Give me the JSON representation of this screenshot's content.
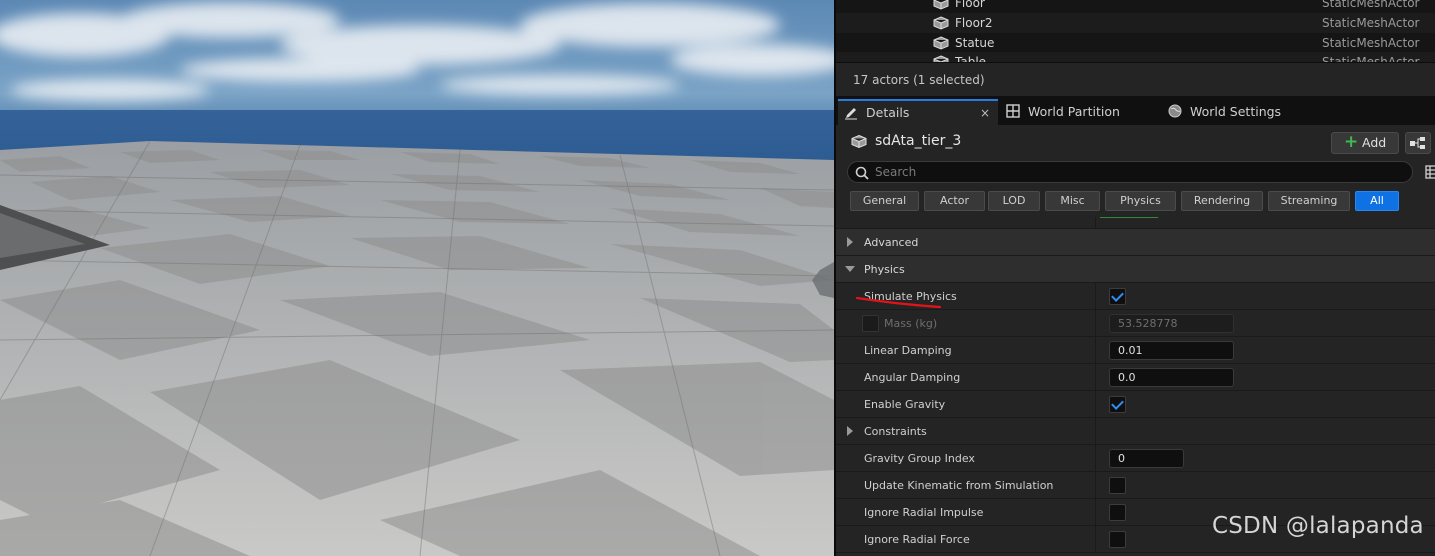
{
  "outliner": {
    "rows": [
      {
        "name": "Floor",
        "type": "StaticMeshActor"
      },
      {
        "name": "Floor2",
        "type": "StaticMeshActor"
      },
      {
        "name": "Statue",
        "type": "StaticMeshActor"
      },
      {
        "name": "Table",
        "type": "StaticMeshActor"
      }
    ],
    "status": "17 actors (1 selected)"
  },
  "tabs": [
    {
      "label": "Details",
      "icon": "pencil-icon"
    },
    {
      "label": "World Partition",
      "icon": "grid-icon"
    },
    {
      "label": "World Settings",
      "icon": "globe-icon"
    }
  ],
  "tab_close": "×",
  "details": {
    "actor_name": "sdAta_tier_3",
    "add_label": "Add",
    "search_placeholder": "Search",
    "filters": [
      "General",
      "Actor",
      "LOD",
      "Misc",
      "Physics",
      "Rendering",
      "Streaming",
      "All"
    ],
    "active_filter": "All",
    "sections": {
      "advanced": "Advanced",
      "physics": "Physics",
      "constraints": "Constraints"
    },
    "properties": {
      "simulate_physics": {
        "label": "Simulate Physics",
        "checked": true
      },
      "mass": {
        "label": "Mass (kg)",
        "value": "53.528778",
        "enabled": false
      },
      "linear_damping": {
        "label": "Linear Damping",
        "value": "0.01"
      },
      "angular_damping": {
        "label": "Angular Damping",
        "value": "0.0"
      },
      "enable_gravity": {
        "label": "Enable Gravity",
        "checked": true
      },
      "gravity_group_index": {
        "label": "Gravity Group Index",
        "value": "0"
      },
      "update_kinematic": {
        "label": "Update Kinematic from Simulation",
        "checked": false
      },
      "ignore_radial_impulse": {
        "label": "Ignore Radial Impulse",
        "checked": false
      },
      "ignore_radial_force": {
        "label": "Ignore Radial Force",
        "checked": false
      }
    }
  },
  "colors": {
    "accent": "#0e72e4",
    "annotation": "#e0141b",
    "panel": "#242424"
  },
  "watermark": "CSDN @lalapanda"
}
